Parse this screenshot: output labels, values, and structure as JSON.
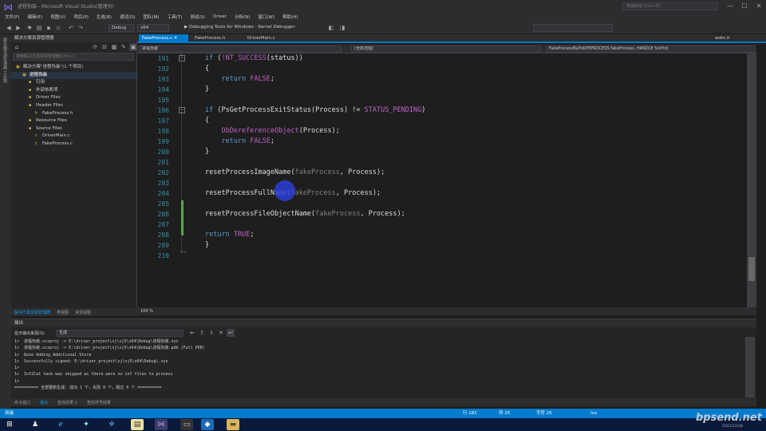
{
  "window": {
    "title": "进程伪装 - Microsoft Visual Studio(管理员)",
    "quick_launch": "快速启动 (Ctrl+Q)",
    "min": "—",
    "max": "☐",
    "close": "✕"
  },
  "menu": [
    "文件(F)",
    "编辑(E)",
    "视图(V)",
    "项目(P)",
    "生成(B)",
    "调试(D)",
    "团队(M)",
    "工具(T)",
    "测试(S)",
    "Driver",
    "分析(N)",
    "窗口(W)",
    "帮助(H)"
  ],
  "toolbar": {
    "config": "Debug",
    "platform": "x64",
    "run_target": "▶ Debugging Tools for Windows - Kernel Debugger"
  },
  "left_strip": "服务器资源管理器 工具箱",
  "solution_explorer": {
    "title": "解决方案资源管理器",
    "search_placeholder": "搜索解决方案资源管理器(Ctrl+;)",
    "items": [
      {
        "label": "解决方案\"进程伪装\"(1 个项目)",
        "indent": 0,
        "icon": "▣"
      },
      {
        "label": "进程伪装",
        "indent": 1,
        "icon": "▣",
        "bold": true
      },
      {
        "label": "引用",
        "indent": 2,
        "icon": "▪"
      },
      {
        "label": "外部依赖项",
        "indent": 2,
        "icon": "▪"
      },
      {
        "label": "Driver Files",
        "indent": 2,
        "icon": "▪"
      },
      {
        "label": "Header Files",
        "indent": 2,
        "icon": "▪"
      },
      {
        "label": "FakeProcess.h",
        "indent": 3,
        "icon": "h"
      },
      {
        "label": "Resource Files",
        "indent": 2,
        "icon": "▪"
      },
      {
        "label": "Source Files",
        "indent": 2,
        "icon": "▪"
      },
      {
        "label": "DriverMain.c",
        "indent": 3,
        "icon": "c"
      },
      {
        "label": "FakeProcess.c",
        "indent": 3,
        "icon": "c"
      }
    ],
    "tabs": [
      "解决方案资源管理器",
      "类视图",
      "资源视图"
    ]
  },
  "doc_tabs": [
    {
      "label": "FakeProcess.c",
      "active": true
    },
    {
      "label": "FakeProcess.h",
      "active": false
    },
    {
      "label": "DriverMain.c",
      "active": false
    },
    {
      "label": "wdm.h",
      "active": false
    }
  ],
  "nav": {
    "project": "进程伪装",
    "scope": "(全局范围)",
    "function": "FakeProcessByPid(PEPROCESS fakeProcess, HANDLE SrcPid)"
  },
  "code_lines": [
    {
      "n": "191",
      "html": "<span class=\"kw\">if</span> (<span class=\"mac\">!NT_SUCCESS</span>(status))"
    },
    {
      "n": "192",
      "html": "{"
    },
    {
      "n": "193",
      "html": "    <span class=\"kw\">return</span> <span class=\"mac\">FALSE</span>;"
    },
    {
      "n": "194",
      "html": "}"
    },
    {
      "n": "195",
      "html": ""
    },
    {
      "n": "196",
      "html": "<span class=\"kw\">if</span> (PsGetProcessExitStatus(Process) != <span class=\"mac\">STATUS_PENDING</span>)"
    },
    {
      "n": "197",
      "html": "{"
    },
    {
      "n": "198",
      "html": "    <span class=\"mac\">ObDereferenceObject</span>(Process);"
    },
    {
      "n": "199",
      "html": "    <span class=\"kw\">return</span> <span class=\"mac\">FALSE</span>;"
    },
    {
      "n": "200",
      "html": "}"
    },
    {
      "n": "201",
      "html": ""
    },
    {
      "n": "202",
      "html": "resetProcessImageName(<span class=\"param\">fakeProcess</span>, Process);"
    },
    {
      "n": "203",
      "html": ""
    },
    {
      "n": "204",
      "html": "resetProcessFullName(<span class=\"param\">fakeProcess</span>, Process);"
    },
    {
      "n": "205",
      "html": ""
    },
    {
      "n": "206",
      "html": "resetProcessFileObjectName(<span class=\"param\">fakeProcess</span>, Process);"
    },
    {
      "n": "207",
      "html": ""
    },
    {
      "n": "208",
      "html": "<span class=\"kw\">return</span> <span class=\"mac\">TRUE</span>;"
    },
    {
      "n": "209",
      "html": "}"
    },
    {
      "n": "210",
      "html": ""
    }
  ],
  "editor_zoom": "100 %",
  "output": {
    "title": "输出",
    "source_label": "显示输出来源(S):",
    "source": "生成",
    "text": "1>  进程伪装.vcxproj -> E:\\driver_project\\xj\\xj5\\x64\\Debug\\进程伪装.sys\n1>  进程伪装.vcxproj -> E:\\driver_project\\xj\\xj5\\x64\\Debug\\进程伪装.pdb (Full PDB)\n1>  Done Adding Additional Store\n1>  Successfully signed: E:\\driver_project\\xj\\xj5\\x64\\Debug\\.sys\n1>\n1>  Inf2Cat task was skipped as there were no inf files to process\n1>\n========== 全部重新生成: 成功 1 个，失败 0 个，跳过 0 个 =========="
  },
  "bottom_tabs": [
    "命令窗口",
    "输出",
    "查找结果 1",
    "查找符号结果"
  ],
  "status": {
    "left": "就绪",
    "line": "行 181",
    "col": "列 25",
    "ch": "字符 25",
    "ins": "Ins"
  },
  "watermark": "bpsend.net",
  "clock": "2021/12/28"
}
